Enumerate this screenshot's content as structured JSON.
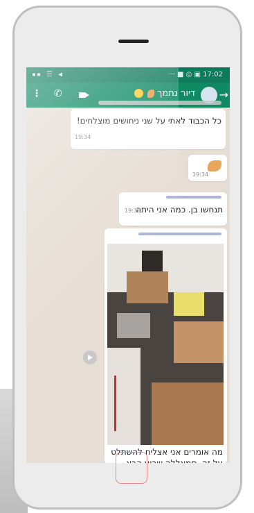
{
  "status": {
    "left_icons": "▪▪ ☰ ◀",
    "right_icons": "··· ■ ◎ ▣",
    "time": "17:02"
  },
  "chat_header": {
    "contact_name": "דיור נתמך"
  },
  "messages": [
    {
      "text": "כל הכבוד לאתי על שני ניחושים מוצלחים!",
      "time": "19:34"
    },
    {
      "text": "",
      "time": "19:34"
    },
    {
      "text": "תנחשו בן. כמה אני היתה",
      "time": "19:36"
    },
    {
      "text": "מה אומרים אני אצליח להשתלט על זה. סמאללה שבוע הבא המעבר"
    }
  ],
  "colors": {
    "status_bar": "#0e7a5b",
    "app_bar": "#0f8a63",
    "chat_bg": "#e6ddd4"
  }
}
